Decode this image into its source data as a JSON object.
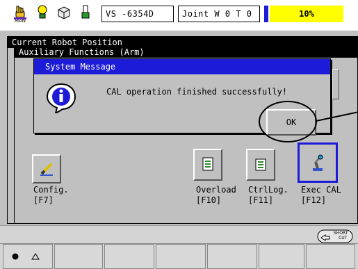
{
  "toolbar": {
    "mode_label": "MAN",
    "position_name": "VS  -6354D",
    "joint_status": "Joint  W 0 T 0",
    "speed": "10%"
  },
  "windows": {
    "current_title": "Current Robot Position",
    "aux_title": "Auxiliary Functions (Arm)"
  },
  "dialog": {
    "title": "System Message",
    "message": "CAL operation finished successfully!",
    "ok_label": "OK"
  },
  "functions": [
    {
      "label": "Config.",
      "key": "[F7]",
      "icon": "pencil-icon"
    },
    {
      "label": "Overload",
      "key": "[F10]",
      "icon": "document-icon"
    },
    {
      "label": "CtrlLog.",
      "key": "[F11]",
      "icon": "scroll-icon"
    },
    {
      "label": "Exec CAL",
      "key": "[F12]",
      "icon": "robot-arm-icon"
    }
  ],
  "shortcut": {
    "line1": "SHORT",
    "line2": "CUT"
  },
  "colors": {
    "title_blue": "#1c1cd8",
    "speed_yellow": "#ffff00",
    "panel_gray": "#c0c0c0"
  }
}
